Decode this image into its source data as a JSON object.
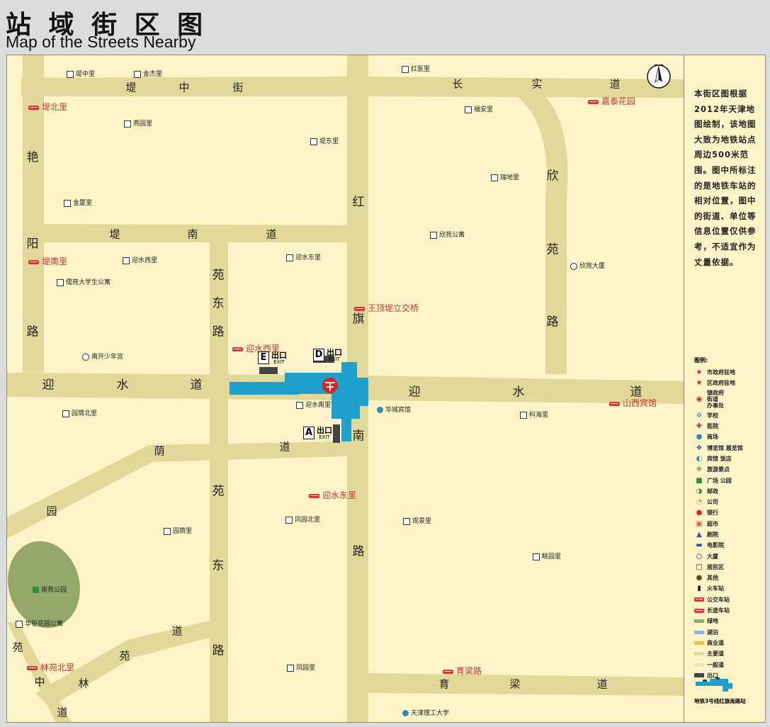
{
  "header": {
    "title_cn": "站 域 街 区 图",
    "title_en": "Map of the Streets Nearby"
  },
  "colors": {
    "background": "#fff4c8",
    "road": "#e2d89a",
    "metro": "#1ea0cc",
    "green": "#93a86a",
    "accent_red": "#c0392b"
  },
  "compass": {
    "label": "N"
  },
  "roads": [
    {
      "label": "堤",
      "big": false
    },
    {
      "label": "中",
      "big": false
    },
    {
      "label": "街",
      "big": false
    },
    {
      "label": "长",
      "big": false
    },
    {
      "label": "实",
      "big": false
    },
    {
      "label": "道",
      "big": false
    },
    {
      "label": "堤",
      "big": false
    },
    {
      "label": "南",
      "big": false
    },
    {
      "label": "道",
      "big": false
    },
    {
      "label": "艳",
      "big": true
    },
    {
      "label": "阳",
      "big": true
    },
    {
      "label": "路",
      "big": true
    },
    {
      "label": "苑",
      "big": true
    },
    {
      "label": "东",
      "big": true
    },
    {
      "label": "路",
      "big": true
    },
    {
      "label": "红",
      "big": true
    },
    {
      "label": "旗",
      "big": true
    },
    {
      "label": "南",
      "big": true
    },
    {
      "label": "路",
      "big": true
    },
    {
      "label": "欣",
      "big": true
    },
    {
      "label": "苑",
      "big": true
    },
    {
      "label": "路",
      "big": true
    },
    {
      "label": "迎",
      "big": true
    },
    {
      "label": "水",
      "big": true
    },
    {
      "label": "道",
      "big": true
    },
    {
      "label": "迎",
      "big": true
    },
    {
      "label": "水",
      "big": true
    },
    {
      "label": "道",
      "big": true
    },
    {
      "label": "荫",
      "big": false
    },
    {
      "label": "道",
      "big": false
    },
    {
      "label": "园",
      "big": false
    },
    {
      "label": "苑",
      "big": true
    },
    {
      "label": "东",
      "big": true
    },
    {
      "label": "路",
      "big": true
    },
    {
      "label": "道",
      "big": false
    },
    {
      "label": "苑",
      "big": false
    },
    {
      "label": "林",
      "big": false
    },
    {
      "label": "苑",
      "big": false
    },
    {
      "label": "中",
      "big": false
    },
    {
      "label": "道",
      "big": false
    },
    {
      "label": "育",
      "big": false
    },
    {
      "label": "梁",
      "big": false
    },
    {
      "label": "道",
      "big": false
    }
  ],
  "places": [
    {
      "label": "堤中里"
    },
    {
      "label": "金杰里"
    },
    {
      "label": "红医里"
    },
    {
      "label": "燕园里"
    },
    {
      "label": "福安里"
    },
    {
      "label": "堤东里"
    },
    {
      "label": "瑞地里"
    },
    {
      "label": "金厦里"
    },
    {
      "label": "欣苑公寓"
    },
    {
      "label": "迎水东里"
    },
    {
      "label": "迎水西里"
    },
    {
      "label": "欣苑大厦"
    },
    {
      "label": "儒苑大学生公寓"
    },
    {
      "label": "南开少年宫"
    },
    {
      "label": "迎水南里"
    },
    {
      "label": "华城宾馆"
    },
    {
      "label": "园荫北里"
    },
    {
      "label": "科海里"
    },
    {
      "label": "观景里"
    },
    {
      "label": "凤园北里"
    },
    {
      "label": "园荫里"
    },
    {
      "label": "眺园里"
    },
    {
      "label": "南苑公园"
    },
    {
      "label": "华钜花园公寓"
    },
    {
      "label": "凤园里"
    },
    {
      "label": "天津理工大学"
    }
  ],
  "stops": [
    {
      "label": "堤北里"
    },
    {
      "label": "嘉泰花园"
    },
    {
      "label": "堤南里"
    },
    {
      "label": "王顶堤立交桥"
    },
    {
      "label": "迎水西里"
    },
    {
      "label": "山西宾馆"
    },
    {
      "label": "迎水东里"
    },
    {
      "label": "林苑北里"
    },
    {
      "label": "育梁路"
    }
  ],
  "exits": [
    {
      "letter": "E",
      "cn": "出口",
      "en": "EXIT"
    },
    {
      "letter": "D",
      "cn": "出口",
      "en": "EXIT"
    },
    {
      "letter": "A",
      "cn": "出口",
      "en": "EXIT"
    }
  ],
  "sidebar": {
    "description": "本街区图根据2012年天津地图绘制，该地图大致为地铁站点周边500米范围。图中所标注的是地铁车站的相对位置，图中的街道、单位等信息位置仅供参考，不适宜作为丈量依据。",
    "legend_title": "图例:",
    "legend": [
      {
        "label": "市政府驻地",
        "icon": "red-star-icon",
        "color": "#d22"
      },
      {
        "label": "区政府驻地",
        "icon": "red-star-small-icon",
        "color": "#d22"
      },
      {
        "label": "镇政府\n街道\n办事处",
        "icon": "red-dot-circle-icon",
        "color": "#d22"
      },
      {
        "label": "学校",
        "icon": "school-icon",
        "color": "#3a7fc4"
      },
      {
        "label": "医院",
        "icon": "hospital-cross-icon",
        "color": "#d22"
      },
      {
        "label": "商场",
        "icon": "mall-icon",
        "color": "#3a7fc4"
      },
      {
        "label": "博览馆 展览馆",
        "icon": "museum-icon",
        "color": "#3a4fa4"
      },
      {
        "label": "宾馆 饭店",
        "icon": "hotel-icon",
        "color": "#2a8fb4"
      },
      {
        "label": "旅游景点",
        "icon": "scenic-icon",
        "color": "#6aa84f"
      },
      {
        "label": "广场 公园",
        "icon": "park-square-icon",
        "color": "#2e8b3e"
      },
      {
        "label": "邮政",
        "icon": "post-icon",
        "color": "#2e8b3e"
      },
      {
        "label": "公司",
        "icon": "company-icon",
        "color": "#e69138"
      },
      {
        "label": "银行",
        "icon": "bank-icon",
        "color": "#d22"
      },
      {
        "label": "超市",
        "icon": "supermarket-icon",
        "color": "#d55"
      },
      {
        "label": "剧院",
        "icon": "theater-icon",
        "color": "#3a4fa4"
      },
      {
        "label": "电影院",
        "icon": "cinema-icon",
        "color": "#3a4fa4"
      },
      {
        "label": "大厦",
        "icon": "building-circle-icon",
        "color": "#222"
      },
      {
        "label": "居民区",
        "icon": "residential-square-icon",
        "color": "#222"
      },
      {
        "label": "其他",
        "icon": "other-icon",
        "color": "#5a4a2a"
      },
      {
        "label": "火车站",
        "icon": "train-station-icon",
        "color": "#222"
      },
      {
        "label": "公交车站",
        "icon": "bus-stop-icon",
        "color": "#d22"
      },
      {
        "label": "长途车站",
        "icon": "coach-station-icon",
        "color": "#d22"
      },
      {
        "label": "绿地",
        "icon": "greenland-swatch",
        "color": "#93a86a"
      },
      {
        "label": "湖泊",
        "icon": "lake-swatch",
        "color": "#8ab4e0"
      },
      {
        "label": "商业道",
        "icon": "commercial-road-swatch",
        "color": "#f1c232"
      },
      {
        "label": "主要道",
        "icon": "main-road-swatch",
        "color": "#e2d89a"
      },
      {
        "label": "一般道",
        "icon": "minor-road-swatch",
        "color": "#ece4b8"
      },
      {
        "label": "出口",
        "icon": "exit-swatch",
        "color": "#444"
      }
    ],
    "station_caption": "地铁3号线红旗南路站"
  }
}
